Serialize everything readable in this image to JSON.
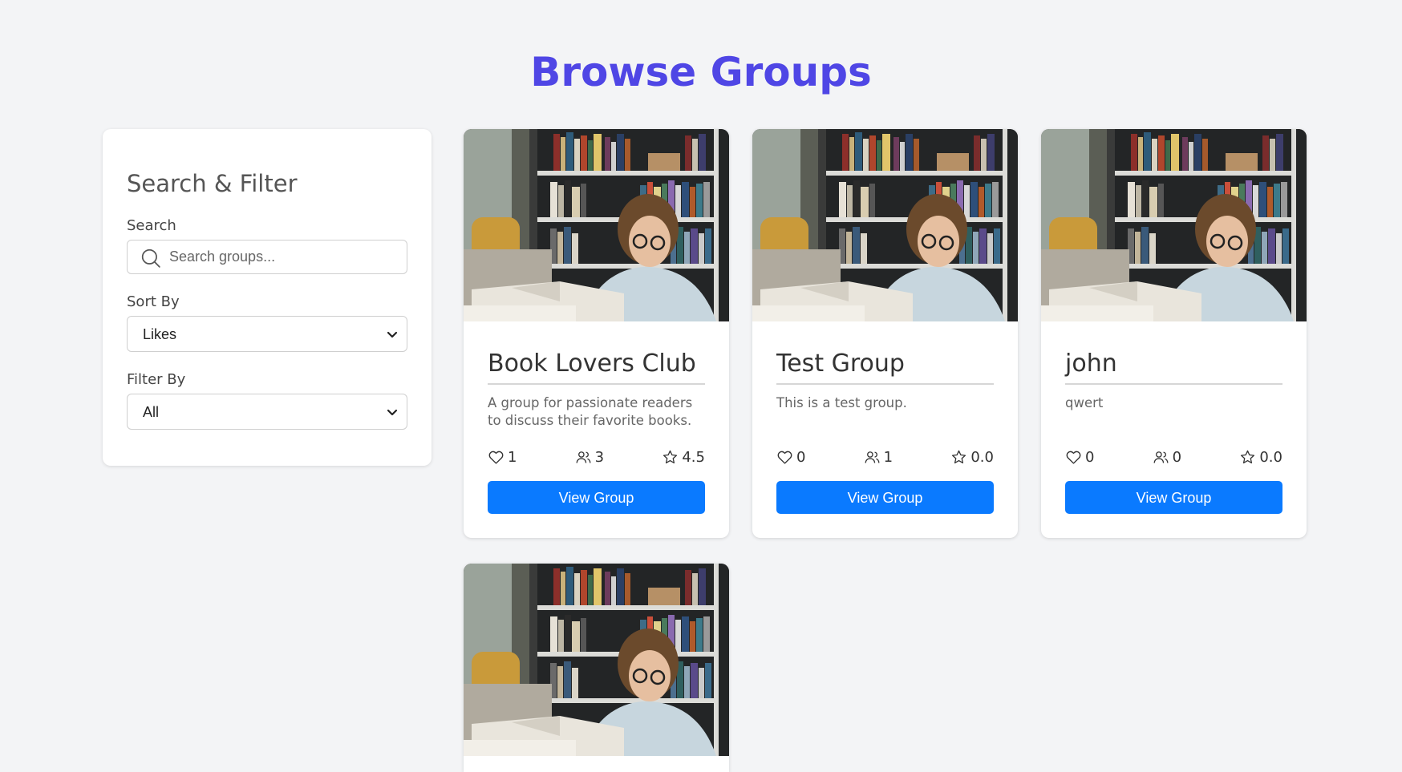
{
  "page": {
    "title": "Browse Groups"
  },
  "sidebar": {
    "title": "Search & Filter",
    "search": {
      "label": "Search",
      "placeholder": "Search groups...",
      "value": ""
    },
    "sort": {
      "label": "Sort By",
      "selected": "Likes"
    },
    "filter": {
      "label": "Filter By",
      "selected": "All"
    }
  },
  "groups": [
    {
      "name": "Book Lovers Club",
      "description": "A group for passionate readers to discuss their favorite books.",
      "likes": "1",
      "members": "3",
      "rating": "4.5",
      "button_label": "View Group"
    },
    {
      "name": "Test Group",
      "description": "This is a test group.",
      "likes": "0",
      "members": "1",
      "rating": "0.0",
      "button_label": "View Group"
    },
    {
      "name": "john",
      "description": "qwert",
      "likes": "0",
      "members": "0",
      "rating": "0.0",
      "button_label": "View Group"
    }
  ],
  "colors": {
    "accent": "#4f46e5",
    "button": "#0a7aff",
    "background": "#f3f4f6"
  },
  "icons": {
    "search": "search-icon",
    "likes": "heart-icon",
    "members": "users-icon",
    "rating": "star-icon",
    "select": "chevron-down-icon"
  }
}
